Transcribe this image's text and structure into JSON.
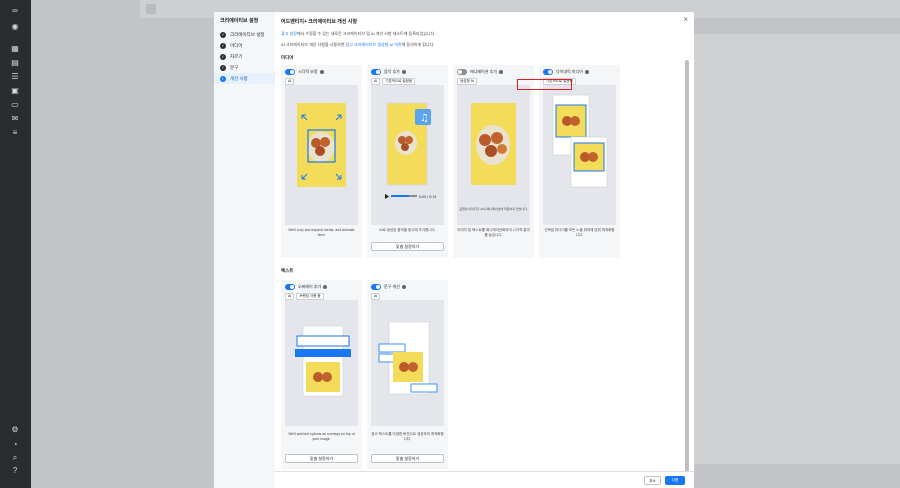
{
  "colors": {
    "accent": "#1877f2",
    "highlight": "#e02020",
    "overlay": "#c3c4c7"
  },
  "modal": {
    "nav_title": "크리에이티브 설정",
    "nav_items": [
      {
        "label": "크리에이티브 설정",
        "state": "done"
      },
      {
        "label": "미디어",
        "state": "done"
      },
      {
        "label": "자르기",
        "state": "done"
      },
      {
        "label": "문구",
        "state": "done"
      },
      {
        "label": "개선 사항",
        "state": "current"
      }
    ],
    "title": "어드밴티지+ 크리에이티브 개선 사항",
    "desc1_link": "광고 설정",
    "desc1_text": "에서 수정할 수 있는 새로운 크리에이티브 및 AI 개선 사항 테스트에 등록되었습니다.",
    "desc2_text": "AI 크리에이티브 개선 사항을 사용하면 ",
    "desc2_link": "광고 크리에이티브 생성형 AI 약관",
    "desc2_end": "에 동의하게 됩니다.",
    "media_label": "미디어",
    "text_label": "텍스트",
    "cards": {
      "visual": {
        "title": "시각적 보정",
        "badge1": "AI",
        "text": "We'll crop and expand media, and animate feed."
      },
      "music": {
        "title": "음악 추가",
        "badge1": "AI",
        "badge2": "기본적으로 설정됨",
        "text": "AI로 생성된 음악을 광고에 추가합니다.",
        "button": "맞춤 설정하기",
        "time": "0:00 / 0:15"
      },
      "animation": {
        "title": "애니메이션 추가",
        "badge1": "생성형 AI",
        "text": "이미지 및 텍스트를 애니메이션화하여 시각적 흥미를 높입니다.",
        "inner_text": "표현의 이미지가 AI의 애니메이션에 적합하지 않습니다."
      },
      "dynamic": {
        "title": "다이내믹 미디어",
        "badge1": "기본적으로 설정됨",
        "text": "선택된 미디어를 모든 노출 위치에 맞춰 최적화합니다."
      },
      "overlay": {
        "title": "오버레이 추가",
        "badge1": "AI",
        "badge2": "브랜딩 사용 중",
        "text": "We'll add text options as overlays on top of your image.",
        "button": "맞춤 설정하기"
      },
      "copy": {
        "title": "문구 개선",
        "badge1": "AI",
        "text": "광고 텍스트를 다양한 버전으로 생성하여 최적화합니다.",
        "button": "맞춤 설정하기"
      }
    },
    "cancel": "취소",
    "next": "다음"
  }
}
